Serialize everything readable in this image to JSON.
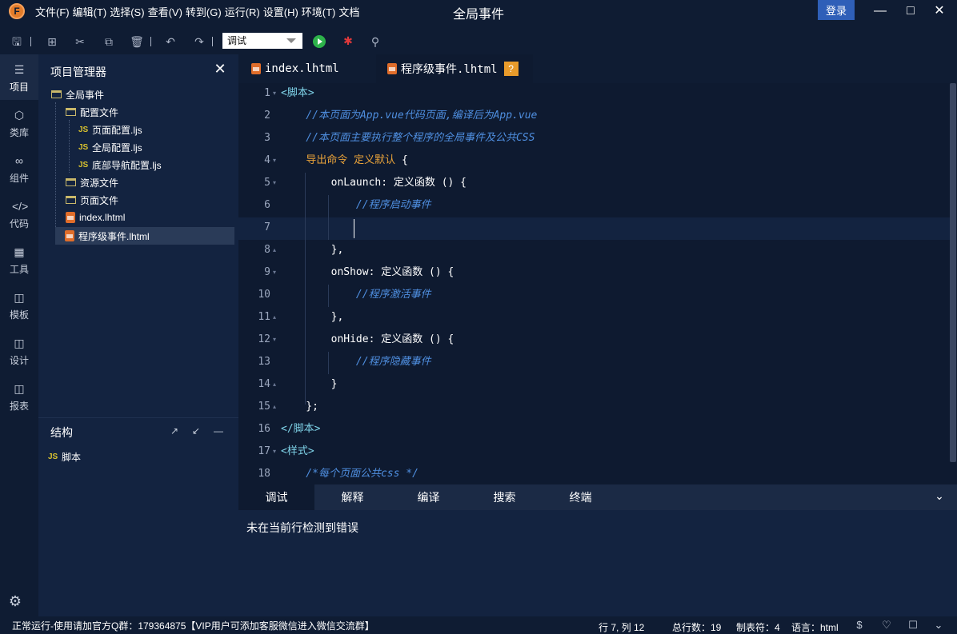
{
  "app": {
    "logo_letter": "F",
    "window_title": "全局事件",
    "login_label": "登录"
  },
  "menu": [
    "文件(F)",
    "编辑(T)",
    "选择(S)",
    "查看(V)",
    "转到(G)",
    "运行(R)",
    "设置(H)",
    "环境(T)",
    "文档"
  ],
  "toolbar": {
    "mode_value": "调试"
  },
  "activity": [
    {
      "label": "项目",
      "icon": "layers-icon"
    },
    {
      "label": "类库",
      "icon": "cube-icon"
    },
    {
      "label": "组件",
      "icon": "link-icon"
    },
    {
      "label": "代码",
      "icon": "code-icon"
    },
    {
      "label": "工具",
      "icon": "tools-icon"
    },
    {
      "label": "模板",
      "icon": "template-icon"
    },
    {
      "label": "设计",
      "icon": "design-icon"
    },
    {
      "label": "报表",
      "icon": "report-icon"
    }
  ],
  "explorer": {
    "title": "项目管理器",
    "tree": [
      {
        "label": "全局事件",
        "type": "folder"
      },
      {
        "label": "配置文件",
        "type": "folder"
      },
      {
        "label": "页面配置.ljs",
        "type": "js"
      },
      {
        "label": "全局配置.ljs",
        "type": "js"
      },
      {
        "label": "底部导航配置.ljs",
        "type": "js"
      },
      {
        "label": "资源文件",
        "type": "folder"
      },
      {
        "label": "页面文件",
        "type": "folder"
      },
      {
        "label": "index.lhtml",
        "type": "lhtml"
      },
      {
        "label": "程序级事件.lhtml",
        "type": "lhtml"
      }
    ]
  },
  "structure": {
    "title": "结构",
    "item_badge": "JS",
    "item_label": "脚本"
  },
  "tabs": {
    "index": "index.lhtml",
    "app": "程序级事件.lhtml",
    "badge": "?"
  },
  "code": {
    "line_numbers": [
      "1",
      "2",
      "3",
      "4",
      "5",
      "6",
      "7",
      "8",
      "9",
      "10",
      "11",
      "12",
      "13",
      "14",
      "15",
      "16",
      "17",
      "18"
    ],
    "lines": [
      [
        {
          "t": "<脚本>",
          "c": "c-tag"
        }
      ],
      [
        {
          "t": "    //本页面为App.vue代码页面,编译后为App.vue",
          "c": "c-comment"
        }
      ],
      [
        {
          "t": "    //本页面主要执行整个程序的全局事件及公共CSS",
          "c": "c-comment"
        }
      ],
      [
        {
          "t": "    ",
          "c": "c-plain"
        },
        {
          "t": "导出命令 定义默认",
          "c": "c-kw"
        },
        {
          "t": " {",
          "c": "c-plain"
        }
      ],
      [
        {
          "t": "        onLaunch: 定义函数 () {",
          "c": "c-plain"
        }
      ],
      [
        {
          "t": "            //程序启动事件",
          "c": "c-comment"
        }
      ],
      [
        {
          "t": "",
          "c": "c-plain"
        }
      ],
      [
        {
          "t": "        },",
          "c": "c-plain"
        }
      ],
      [
        {
          "t": "        onShow: 定义函数 () {",
          "c": "c-plain"
        }
      ],
      [
        {
          "t": "            //程序激活事件",
          "c": "c-comment"
        }
      ],
      [
        {
          "t": "        },",
          "c": "c-plain"
        }
      ],
      [
        {
          "t": "        onHide: 定义函数 () {",
          "c": "c-plain"
        }
      ],
      [
        {
          "t": "            //程序隐藏事件",
          "c": "c-comment"
        }
      ],
      [
        {
          "t": "        }",
          "c": "c-plain"
        }
      ],
      [
        {
          "t": "    };",
          "c": "c-plain"
        }
      ],
      [
        {
          "t": "</脚本>",
          "c": "c-tag"
        }
      ],
      [
        {
          "t": "<样式>",
          "c": "c-tag"
        }
      ],
      [
        {
          "t": "    /*每个页面公共css */",
          "c": "c-comment"
        }
      ]
    ],
    "fold_markers": [
      "▾",
      "",
      "",
      "▾",
      "▾",
      "",
      "",
      "▴",
      "▾",
      "",
      "▴",
      "▾",
      "",
      "▴",
      "▴",
      "",
      "▾",
      ""
    ]
  },
  "panel": {
    "tabs": [
      "调试",
      "解释",
      "编译",
      "搜索",
      "终端"
    ],
    "message": "未在当前行检测到错误"
  },
  "status": {
    "left": "正常运行-使用请加官方Q群：179364875【VIP用户可添加客服微信进入微信交流群】",
    "position": "行 7, 列 12",
    "total_lines": "总行数：19",
    "tab_size": "制表符：4",
    "language": "语言：html"
  },
  "colors": {
    "background": "#0f1c33",
    "editor": "#0e1a30",
    "sidebar": "#132340",
    "accent": "#2f5fb8",
    "comment": "#4f8fe0",
    "keyword": "#e8a23a",
    "tag": "#7fd3e8"
  }
}
